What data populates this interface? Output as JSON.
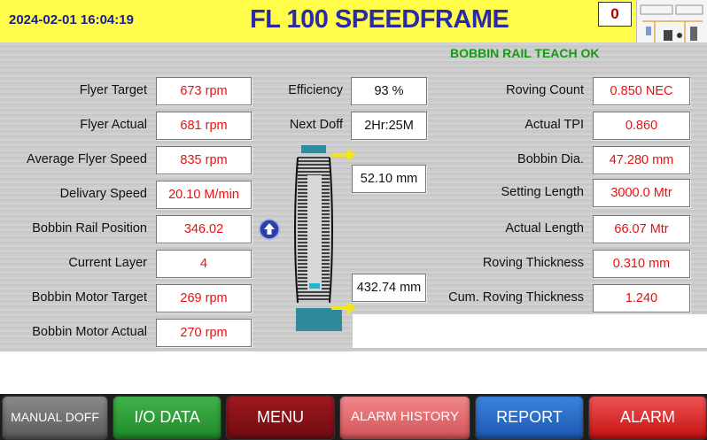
{
  "header": {
    "datetime": "2024-02-01 16:04:19",
    "title": "FL 100 SPEEDFRAME",
    "counter": "0"
  },
  "status_message": "BOBBIN RAIL TEACH OK",
  "left_params": [
    {
      "label": "Flyer Target",
      "value": "673 rpm"
    },
    {
      "label": "Flyer Actual",
      "value": "681 rpm"
    },
    {
      "label": "Average Flyer Speed",
      "value": "835 rpm"
    },
    {
      "label": "Delivary Speed",
      "value": "20.10 M/min"
    },
    {
      "label": "Bobbin Rail Position",
      "value": "346.02"
    },
    {
      "label": "Current Layer",
      "value": "4"
    },
    {
      "label": "Bobbin Motor Target",
      "value": "269 rpm"
    },
    {
      "label": "Bobbin Motor Actual",
      "value": "270 rpm"
    }
  ],
  "middle_params": [
    {
      "label": "Efficiency",
      "value": "93 %"
    },
    {
      "label": "Next Doff",
      "value": "2Hr:25M"
    }
  ],
  "bobbin": {
    "top_reading": "52.10 mm",
    "bottom_reading": "432.74 mm"
  },
  "right_params": [
    {
      "label": "Roving Count",
      "value": "0.850 NEC"
    },
    {
      "label": "Actual TPI",
      "value": "0.860"
    },
    {
      "label": "Bobbin Dia.",
      "value": "47.280 mm"
    },
    {
      "label": "Setting Length",
      "value": "3000.0 Mtr"
    },
    {
      "label": "Actual Length",
      "value": "66.07 Mtr"
    },
    {
      "label": "Roving Thickness",
      "value": "0.310 mm"
    },
    {
      "label": "Cum. Roving Thickness",
      "value": "1.240"
    }
  ],
  "buttons": {
    "manual_doff": "MANUAL DOFF",
    "io_data": "I/O DATA",
    "menu": "MENU",
    "alarm_history": "ALARM HISTORY",
    "report": "REPORT",
    "alarm": "ALARM"
  },
  "colors": {
    "header_bg": "#fffc4a",
    "title": "#2a2aa8",
    "value_text": "#e41212",
    "status_ok": "#169a16",
    "bobbin_flange": "#2f8a9b"
  },
  "icons": {
    "rail_direction": "up-arrow-circle-icon",
    "pointer": "right-arrow-icon"
  }
}
